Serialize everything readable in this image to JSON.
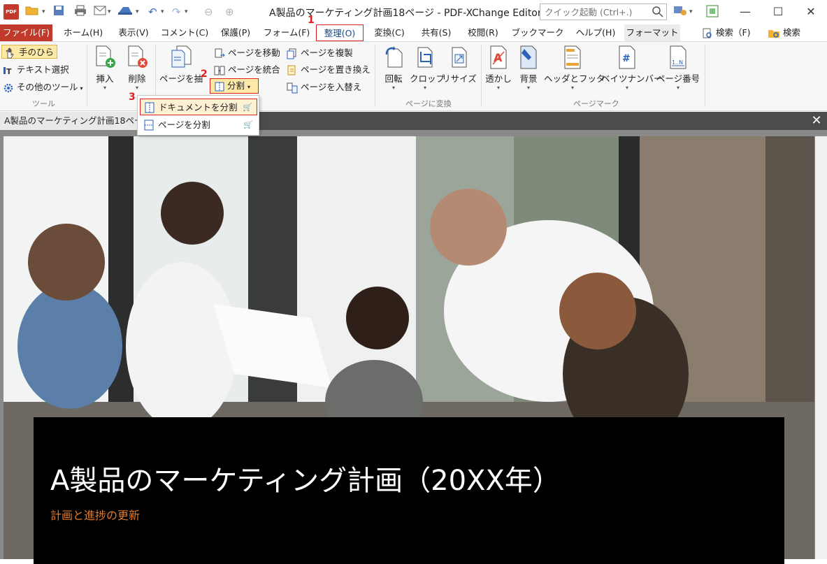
{
  "titlebar": {
    "title": "A製品のマーケティング計画18ページ - PDF-XChange Editor",
    "app_logo": "PDF",
    "quick_launch_placeholder": "クイック起動 (Ctrl+.)",
    "minimize": "—",
    "maximize": "☐",
    "close": "✕"
  },
  "menu": {
    "file": "ファイル(F)",
    "home": "ホーム(H)",
    "view": "表示(V)",
    "comment": "コメント(C)",
    "protect": "保護(P)",
    "form": "フォーム(F)",
    "organize": "整理(O)",
    "convert": "変換(C)",
    "share": "共有(S)",
    "review": "校閲(R)",
    "bookmark": "ブックマーク",
    "help": "ヘルプ(H)",
    "format": "フォーマット",
    "find": "検索（F)",
    "search": "検索"
  },
  "ribbon": {
    "tools": {
      "hand": "手のひら",
      "select_text": "テキスト選択",
      "other_tools": "その他のツール",
      "group_label": "ツール"
    },
    "pages": {
      "insert": "挿入",
      "delete": "削除",
      "extract": "ページを抽",
      "move": "ページを移動",
      "merge": "ページを統合",
      "duplicate": "ページを複製",
      "replace": "ページを置き換え",
      "swap": "ページを入替え",
      "split": "分割"
    },
    "transform": {
      "rotate": "回転",
      "crop": "クロップ",
      "resize": "リサイズ",
      "group_label": "ページに変換"
    },
    "marks": {
      "watermark": "透かし",
      "background": "背景",
      "header_footer": "ヘッダとフッタ",
      "bates": "ベイツナンバー",
      "page_number": "ページ番号",
      "group_label": "ページマーク"
    }
  },
  "dropdown": {
    "split_document": "ドキュメントを分割",
    "split_pages": "ページを分割"
  },
  "steps": [
    "1",
    "2",
    "3"
  ],
  "document": {
    "tab_label": "A製品のマーケティング計画18ペー",
    "close_tab": "✕",
    "title": "A製品のマーケティング計画（20XX年）",
    "subtitle": "計画と進捗の更新"
  },
  "colors": {
    "file_menu": "#c0392b",
    "highlight_border": "#e02020",
    "subtitle": "#e07a2a"
  }
}
